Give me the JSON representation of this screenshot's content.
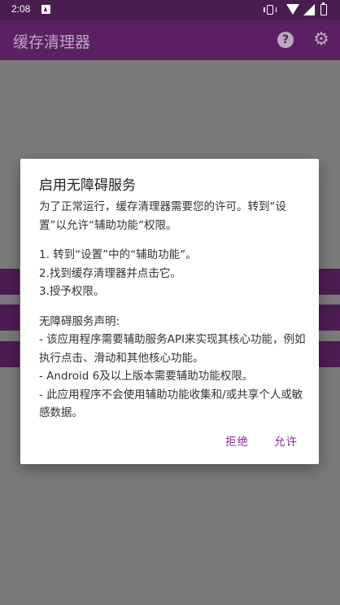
{
  "status_bar": {
    "time": "2:08",
    "icons": [
      "notification-icon",
      "vibrate-icon",
      "wifi-icon",
      "signal-icon",
      "battery-icon"
    ]
  },
  "app_bar": {
    "title": "缓存清理器",
    "help_icon": "help-icon",
    "settings_icon": "gear-icon"
  },
  "dialog": {
    "title": "启用无障碍服务",
    "intro": "为了正常运行，缓存清理器需要您的许可。转到“设置”以允许“辅助功能”权限。",
    "steps": [
      "1. 转到“设置”中的“辅助功能”。",
      "2.找到缓存清理器并点击它。",
      "3.授予权限。"
    ],
    "statement_title": "无障碍服务声明:",
    "statement_lines": [
      "- 该应用程序需要辅助服务API来实现其核心功能，例如执行点击、滑动和其他核心功能。",
      "- Android 6及以上版本需要辅助功能权限。",
      "- 此应用程序不会使用辅助功能收集和/或共享个人或敏感数据。"
    ],
    "reject_label": "拒绝",
    "allow_label": "允许"
  },
  "colors": {
    "status_bar": "#4a1d50",
    "app_bar": "#5b2062",
    "accent": "#8b2a95",
    "scrim": "#7a7a7a"
  }
}
